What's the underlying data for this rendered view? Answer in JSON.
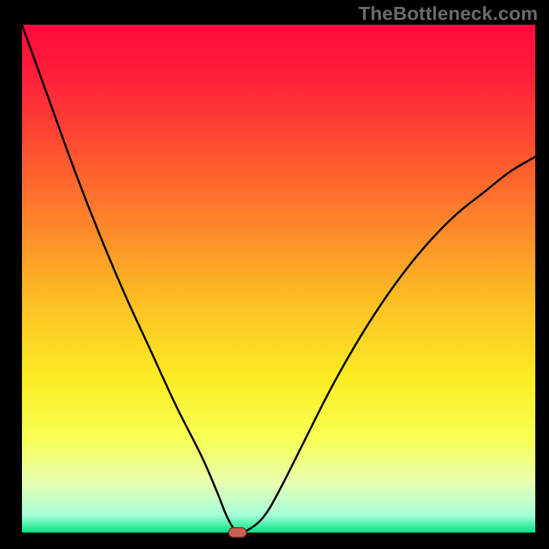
{
  "watermark": "TheBottleneck.com",
  "chart_data": {
    "type": "line",
    "title": "",
    "xlabel": "",
    "ylabel": "",
    "xlim": [
      0,
      100
    ],
    "ylim": [
      0,
      100
    ],
    "curve_description": "V-shaped bottleneck curve: high at x=0, descends steeply to near 0 around x≈42 (minimum), then rises again toward 100 at the right edge",
    "x": [
      0,
      5,
      10,
      15,
      20,
      25,
      30,
      35,
      38,
      40,
      42,
      44,
      47,
      50,
      55,
      60,
      65,
      70,
      75,
      80,
      85,
      90,
      95,
      100
    ],
    "y": [
      100,
      86,
      72,
      59,
      47,
      36,
      25,
      15,
      8,
      3,
      0,
      0.5,
      3,
      8,
      18,
      28,
      37,
      45,
      52,
      58,
      63,
      67,
      71,
      74
    ],
    "optimal_point": {
      "x": 42,
      "y": 0
    },
    "gradient_stops": [
      {
        "pos": 0.0,
        "color": "#ff0a3c"
      },
      {
        "pos": 0.1,
        "color": "#ff1f3a"
      },
      {
        "pos": 0.25,
        "color": "#fe5230"
      },
      {
        "pos": 0.4,
        "color": "#fd892a"
      },
      {
        "pos": 0.55,
        "color": "#fcc024"
      },
      {
        "pos": 0.7,
        "color": "#fbed24"
      },
      {
        "pos": 0.82,
        "color": "#f7ff58"
      },
      {
        "pos": 0.9,
        "color": "#e9ffb0"
      },
      {
        "pos": 0.965,
        "color": "#a7ffdb"
      },
      {
        "pos": 1.0,
        "color": "#00e583"
      }
    ],
    "frame": {
      "margin_left": 32,
      "margin_right": 20,
      "margin_top": 36,
      "margin_bottom": 24,
      "frame_color": "#000000"
    },
    "marker": {
      "color_fill": "#c86056",
      "color_stroke": "#7a2a22",
      "width": 26,
      "height": 14
    }
  }
}
